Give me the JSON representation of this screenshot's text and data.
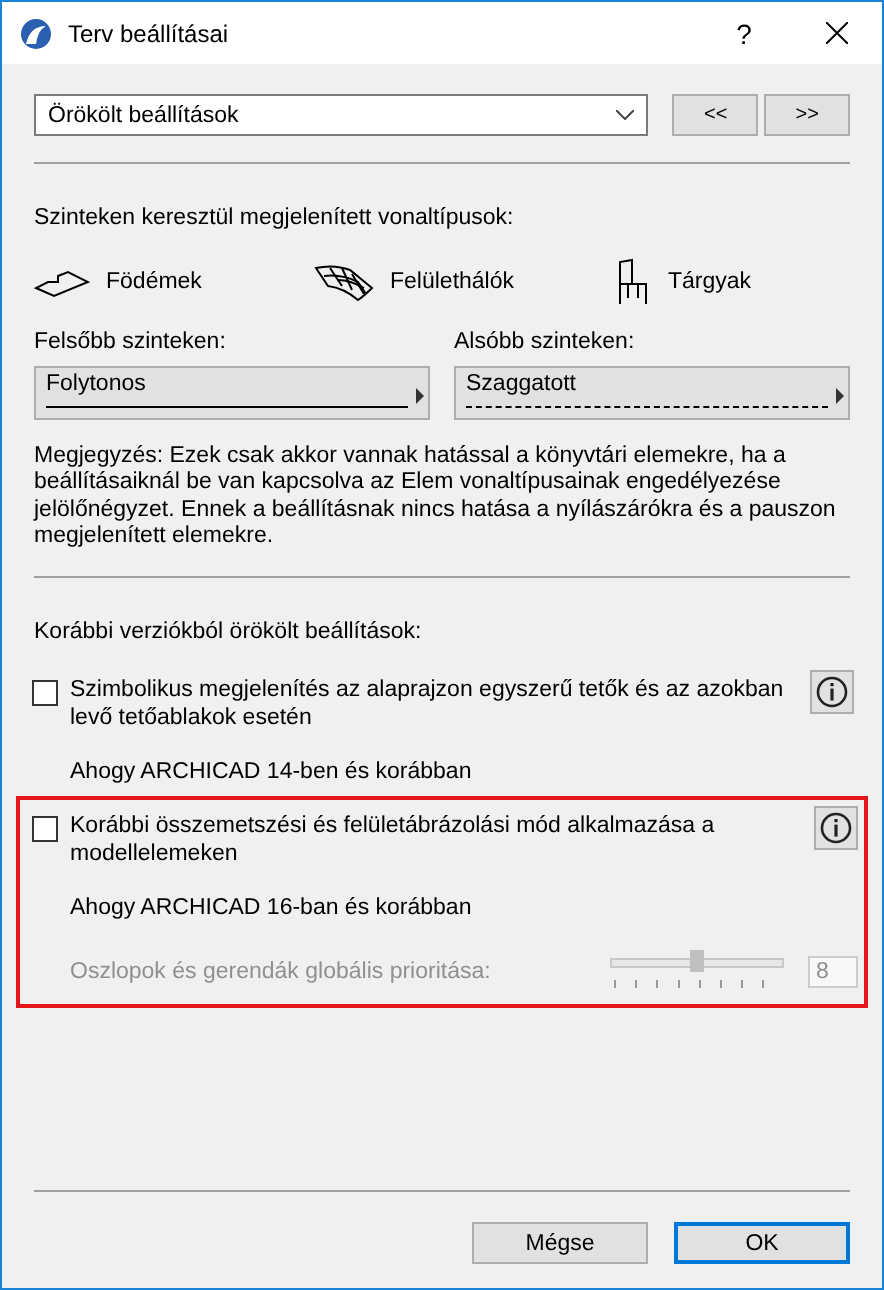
{
  "window": {
    "title": "Terv beállításai",
    "help": "?"
  },
  "preset": {
    "value": "Örökölt beállítások",
    "prev": "<<",
    "next": ">>"
  },
  "linetypes": {
    "heading": "Szinteken keresztül megjelenített vonaltípusok:",
    "categories": [
      {
        "kind": "slab",
        "label": "Födémek"
      },
      {
        "kind": "mesh",
        "label": "Felülethálók"
      },
      {
        "kind": "chair",
        "label": "Tárgyak"
      }
    ],
    "selectors": [
      {
        "label": "Felsőbb szinteken:",
        "value": "Folytonos",
        "dashed": false
      },
      {
        "label": "Alsóbb szinteken:",
        "value": "Szaggatott",
        "dashed": true
      }
    ]
  },
  "note": "Megjegyzés: Ezek csak akkor vannak hatással a könyvtári elemekre, ha a beállításaiknál be van kapcsolva az Elem vonaltípusainak engedélyezése jelölőnégyzet. Ennek a beállításnak nincs hatása a nyílászárókra és a pauszon megjelenített elemekre.",
  "legacy": {
    "heading": "Korábbi verziókból örökölt beállítások:",
    "options": [
      {
        "label": "Szimbolikus megjelenítés az alaprajzon egyszerű tetők és az azokban levő tetőablakok esetén",
        "checked": false,
        "highlighted": false,
        "note": "Ahogy ARCHICAD 14-ben és korábban"
      },
      {
        "label": "Korábbi összemetszési és felületábrázolási mód alkalmazása a modellelemeken",
        "checked": false,
        "highlighted": true,
        "note": "Ahogy ARCHICAD 16-ban és korábban",
        "slider": {
          "label": "Oszlopok és gerendák globális prioritása:",
          "level": 0.5,
          "value": "8",
          "disabled": true
        }
      }
    ]
  },
  "buttons": [
    {
      "label": "Mégse",
      "default": false
    },
    {
      "label": "OK",
      "default": true
    }
  ]
}
